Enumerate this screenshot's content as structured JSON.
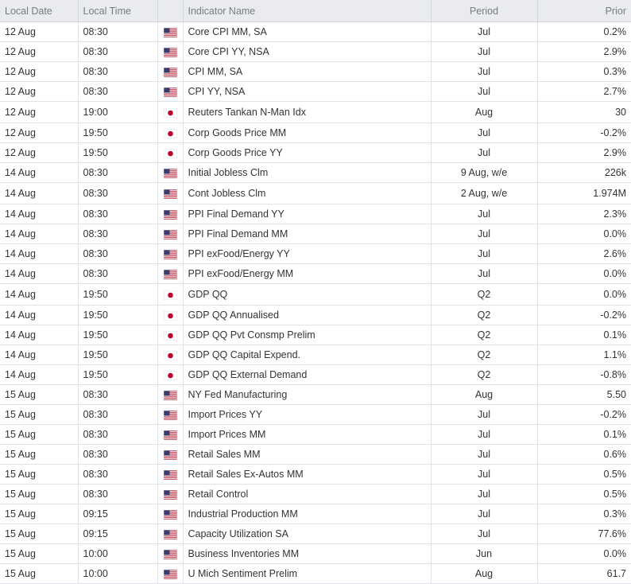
{
  "headers": {
    "local_date": "Local Date",
    "local_time": "Local Time",
    "flag": "",
    "indicator_name": "Indicator Name",
    "period": "Period",
    "prior": "Prior"
  },
  "rows": [
    {
      "date": "12 Aug",
      "time": "08:30",
      "country": "us",
      "flag_icon": "us-flag-icon",
      "name": "Core CPI MM, SA",
      "period": "Jul",
      "prior": "0.2%"
    },
    {
      "date": "12 Aug",
      "time": "08:30",
      "country": "us",
      "flag_icon": "us-flag-icon",
      "name": "Core CPI YY, NSA",
      "period": "Jul",
      "prior": "2.9%"
    },
    {
      "date": "12 Aug",
      "time": "08:30",
      "country": "us",
      "flag_icon": "us-flag-icon",
      "name": "CPI MM, SA",
      "period": "Jul",
      "prior": "0.3%"
    },
    {
      "date": "12 Aug",
      "time": "08:30",
      "country": "us",
      "flag_icon": "us-flag-icon",
      "name": "CPI YY, NSA",
      "period": "Jul",
      "prior": "2.7%"
    },
    {
      "date": "12 Aug",
      "time": "19:00",
      "country": "jp",
      "flag_icon": "jp-flag-icon",
      "name": "Reuters Tankan N-Man Idx",
      "period": "Aug",
      "prior": "30"
    },
    {
      "date": "12 Aug",
      "time": "19:50",
      "country": "jp",
      "flag_icon": "jp-flag-icon",
      "name": "Corp Goods Price MM",
      "period": "Jul",
      "prior": "-0.2%"
    },
    {
      "date": "12 Aug",
      "time": "19:50",
      "country": "jp",
      "flag_icon": "jp-flag-icon",
      "name": "Corp Goods Price YY",
      "period": "Jul",
      "prior": "2.9%"
    },
    {
      "date": "14 Aug",
      "time": "08:30",
      "country": "us",
      "flag_icon": "us-flag-icon",
      "name": "Initial Jobless Clm",
      "period": "9 Aug, w/e",
      "prior": "226k"
    },
    {
      "date": "14 Aug",
      "time": "08:30",
      "country": "us",
      "flag_icon": "us-flag-icon",
      "name": "Cont Jobless Clm",
      "period": "2 Aug, w/e",
      "prior": "1.974M"
    },
    {
      "date": "14 Aug",
      "time": "08:30",
      "country": "us",
      "flag_icon": "us-flag-icon",
      "name": "PPI Final Demand YY",
      "period": "Jul",
      "prior": "2.3%"
    },
    {
      "date": "14 Aug",
      "time": "08:30",
      "country": "us",
      "flag_icon": "us-flag-icon",
      "name": "PPI Final Demand MM",
      "period": "Jul",
      "prior": "0.0%"
    },
    {
      "date": "14 Aug",
      "time": "08:30",
      "country": "us",
      "flag_icon": "us-flag-icon",
      "name": "PPI exFood/Energy YY",
      "period": "Jul",
      "prior": "2.6%"
    },
    {
      "date": "14 Aug",
      "time": "08:30",
      "country": "us",
      "flag_icon": "us-flag-icon",
      "name": "PPI exFood/Energy MM",
      "period": "Jul",
      "prior": "0.0%"
    },
    {
      "date": "14 Aug",
      "time": "19:50",
      "country": "jp",
      "flag_icon": "jp-flag-icon",
      "name": "GDP QQ",
      "period": "Q2",
      "prior": "0.0%"
    },
    {
      "date": "14 Aug",
      "time": "19:50",
      "country": "jp",
      "flag_icon": "jp-flag-icon",
      "name": "GDP QQ Annualised",
      "period": "Q2",
      "prior": "-0.2%"
    },
    {
      "date": "14 Aug",
      "time": "19:50",
      "country": "jp",
      "flag_icon": "jp-flag-icon",
      "name": "GDP QQ Pvt Consmp Prelim",
      "period": "Q2",
      "prior": "0.1%"
    },
    {
      "date": "14 Aug",
      "time": "19:50",
      "country": "jp",
      "flag_icon": "jp-flag-icon",
      "name": "GDP QQ Capital Expend.",
      "period": "Q2",
      "prior": "1.1%"
    },
    {
      "date": "14 Aug",
      "time": "19:50",
      "country": "jp",
      "flag_icon": "jp-flag-icon",
      "name": "GDP QQ External Demand",
      "period": "Q2",
      "prior": "-0.8%"
    },
    {
      "date": "15 Aug",
      "time": "08:30",
      "country": "us",
      "flag_icon": "us-flag-icon",
      "name": "NY Fed Manufacturing",
      "period": "Aug",
      "prior": "5.50"
    },
    {
      "date": "15 Aug",
      "time": "08:30",
      "country": "us",
      "flag_icon": "us-flag-icon",
      "name": "Import Prices YY",
      "period": "Jul",
      "prior": "-0.2%"
    },
    {
      "date": "15 Aug",
      "time": "08:30",
      "country": "us",
      "flag_icon": "us-flag-icon",
      "name": "Import Prices MM",
      "period": "Jul",
      "prior": "0.1%"
    },
    {
      "date": "15 Aug",
      "time": "08:30",
      "country": "us",
      "flag_icon": "us-flag-icon",
      "name": "Retail Sales MM",
      "period": "Jul",
      "prior": "0.6%"
    },
    {
      "date": "15 Aug",
      "time": "08:30",
      "country": "us",
      "flag_icon": "us-flag-icon",
      "name": "Retail Sales Ex-Autos MM",
      "period": "Jul",
      "prior": "0.5%"
    },
    {
      "date": "15 Aug",
      "time": "08:30",
      "country": "us",
      "flag_icon": "us-flag-icon",
      "name": "Retail Control",
      "period": "Jul",
      "prior": "0.5%"
    },
    {
      "date": "15 Aug",
      "time": "09:15",
      "country": "us",
      "flag_icon": "us-flag-icon",
      "name": "Industrial Production MM",
      "period": "Jul",
      "prior": "0.3%"
    },
    {
      "date": "15 Aug",
      "time": "09:15",
      "country": "us",
      "flag_icon": "us-flag-icon",
      "name": "Capacity Utilization SA",
      "period": "Jul",
      "prior": "77.6%"
    },
    {
      "date": "15 Aug",
      "time": "10:00",
      "country": "us",
      "flag_icon": "us-flag-icon",
      "name": "Business Inventories MM",
      "period": "Jun",
      "prior": "0.0%"
    },
    {
      "date": "15 Aug",
      "time": "10:00",
      "country": "us",
      "flag_icon": "us-flag-icon",
      "name": "U Mich Sentiment Prelim",
      "period": "Aug",
      "prior": "61.7"
    }
  ],
  "colors": {
    "header_bg": "#e9ebee",
    "header_text": "#777b82",
    "grid_line": "#dfe2e6",
    "us_blue": "#3c3b6e",
    "us_red": "#b22234",
    "jp_red": "#bc002d"
  }
}
